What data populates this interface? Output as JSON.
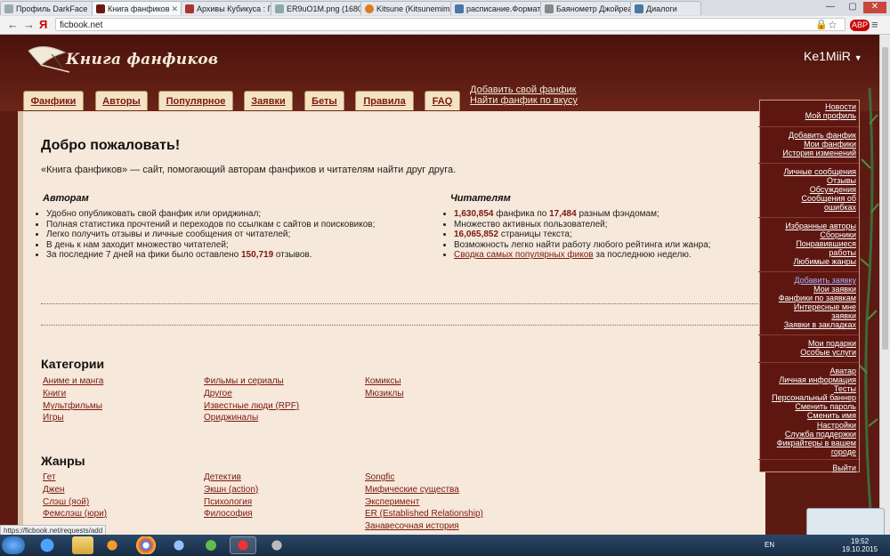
{
  "browser": {
    "tabs": [
      {
        "title": "Профиль DarkFace",
        "active": false
      },
      {
        "title": "Книга фанфиков",
        "active": true
      },
      {
        "title": "Архивы Кубикуса : П",
        "active": false
      },
      {
        "title": "ER9uO1M.png (1680",
        "active": false
      },
      {
        "title": "Kitsune (Kitsunemimi",
        "active": false
      },
      {
        "title": "расписание.Формат Р",
        "active": false
      },
      {
        "title": "Баянометр Джойреа",
        "active": false
      },
      {
        "title": "Диалоги",
        "active": false
      }
    ],
    "url": "ficbook.net",
    "status_url": "https://ficbook.net/requests/add"
  },
  "site": {
    "logo_text": "Книга фанфиков",
    "username": "Ke1MiiR",
    "nav": [
      "Фанфики",
      "Авторы",
      "Популярное",
      "Заявки",
      "Беты",
      "Правила",
      "FAQ"
    ],
    "top_links": [
      "Добавить свой фанфик",
      "Найти фанфик по вкусу"
    ]
  },
  "main": {
    "heading": "Добро пожаловать!",
    "intro": "«Книга фанфиков» — сайт, помогающий авторам фанфиков и читателям найти друг друга.",
    "authors_heading": "Авторам",
    "authors_items": [
      "Удобно опубликовать свой фанфик или ориджинал;",
      "Полная статистика прочтений и переходов по ссылкам с сайтов и поисковиков;",
      "Легко получить отзывы и личные сообщения от читателей;",
      "В день к нам заходит множество читателей;"
    ],
    "authors_last": {
      "pre": "За последние 7 дней на фики было оставлено ",
      "num": "150,719",
      "post": " отзывов."
    },
    "readers_heading": "Читателям",
    "readers_1": {
      "num1": "1,630,854",
      "mid": " фанфика по ",
      "num2": "17,484",
      "post": " разным фэндомам;"
    },
    "readers_2": "Множество активных пользователей;",
    "readers_3": {
      "num": "16,065,852",
      "post": " страницы текста;"
    },
    "readers_4": "Возможность легко найти работу любого рейтинга или жанра;",
    "readers_5": {
      "link": "Сводка самых популярных фиков",
      "post": " за последнюю неделю."
    },
    "categories_heading": "Категории",
    "categories": [
      [
        "Аниме и манга",
        "Книги",
        "Мультфильмы",
        "Игры"
      ],
      [
        "Фильмы и сериалы",
        "Другое",
        "Известные люди (RPF)",
        "Ориджиналы"
      ],
      [
        "Комиксы",
        "Мюзиклы"
      ]
    ],
    "genres_heading": "Жанры",
    "genres": [
      [
        "Гет",
        "Джен",
        "Слэш (яой)",
        "Фемслэш (юри)"
      ],
      [
        "Детектив",
        "Экшн (action)",
        "Психология",
        "Философия"
      ],
      [
        "Songfic",
        "Мифические существа",
        "Эксперимент",
        "ER (Established Relationship)",
        "Занавесочная история"
      ]
    ]
  },
  "side_menu": {
    "groups": [
      [
        "Новости",
        "Мой профиль"
      ],
      [
        "Добавить фанфик",
        "Мои фанфики",
        "История изменений"
      ],
      [
        "Личные сообщения",
        "Отзывы",
        "Обсуждения",
        "Сообщения об",
        "ошибках"
      ],
      [
        "Избранные авторы",
        "Сборники",
        "Понравившиеся",
        "работы",
        "Любимые жанры"
      ],
      [
        "Добавить заявку",
        "Мои заявки",
        "Фанфики по заявкам",
        "Интересные мне",
        "заявки",
        "Заявки в закладках"
      ],
      [
        "Мои подарки",
        "Особые услуги"
      ],
      [
        "Аватар",
        "Личная информация",
        "Тесты",
        "Персональный баннер",
        "Сменить пароль",
        "Сменить имя",
        "Настройки",
        "Служба поддержки",
        "Фикрайтеры в вашем",
        "городе"
      ],
      [
        "Выйти"
      ]
    ]
  },
  "taskbar": {
    "lang": "EN",
    "time": "19:52",
    "date": "19.10.2015"
  }
}
